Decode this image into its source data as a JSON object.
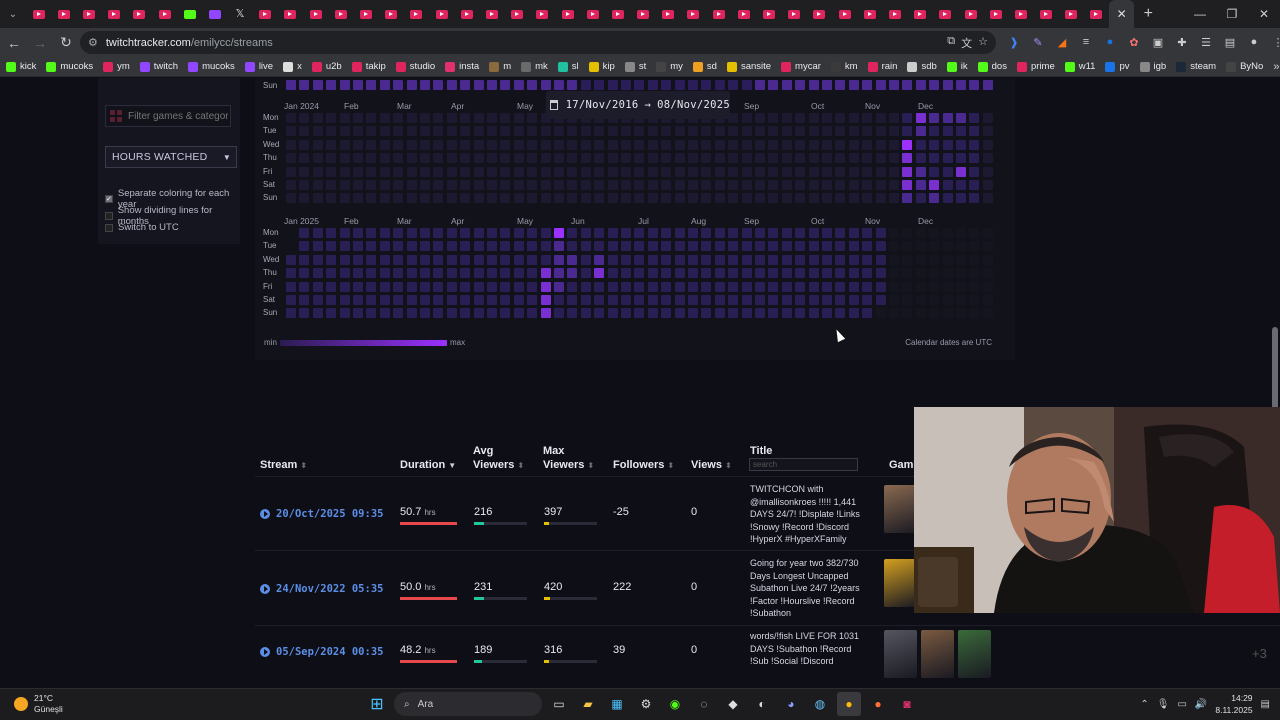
{
  "browser": {
    "tab_count": 44,
    "new_tab": "+",
    "controls": {
      "minimize": "—",
      "maximize": "❐",
      "close": "✕"
    },
    "url_host": "twitchtracker.com",
    "url_path": "/emilycc/streams",
    "bookmarks": [
      {
        "label": "kick",
        "color": "#53fc18"
      },
      {
        "label": "mucoks",
        "color": "#53fc18"
      },
      {
        "label": "ym",
        "color": "#e0245e"
      },
      {
        "label": "twitch",
        "color": "#9146ff"
      },
      {
        "label": "mucoks",
        "color": "#9146ff"
      },
      {
        "label": "live",
        "color": "#9146ff"
      },
      {
        "label": "x",
        "color": "#dddddd"
      },
      {
        "label": "u2b",
        "color": "#e0245e"
      },
      {
        "label": "takip",
        "color": "#e0245e"
      },
      {
        "label": "studio",
        "color": "#e0245e"
      },
      {
        "label": "insta",
        "color": "#e1306c"
      },
      {
        "label": "m",
        "color": "#8a6a3a"
      },
      {
        "label": "mk",
        "color": "#6a6a6a"
      },
      {
        "label": "sl",
        "color": "#20c0a0"
      },
      {
        "label": "kip",
        "color": "#e5c000"
      },
      {
        "label": "st",
        "color": "#888888"
      },
      {
        "label": "my",
        "color": "#444444"
      },
      {
        "label": "sd",
        "color": "#f0a020"
      },
      {
        "label": "sansite",
        "color": "#e5c000"
      },
      {
        "label": "mycar",
        "color": "#e0245e"
      },
      {
        "label": "km",
        "color": "#3a3a3a"
      },
      {
        "label": "rain",
        "color": "#e0245e"
      },
      {
        "label": "sdb",
        "color": "#cccccc"
      },
      {
        "label": "ik",
        "color": "#53fc18"
      },
      {
        "label": "dos",
        "color": "#53fc18"
      },
      {
        "label": "prime",
        "color": "#e0245e"
      },
      {
        "label": "w11",
        "color": "#53fc18"
      },
      {
        "label": "pv",
        "color": "#1a73e8"
      },
      {
        "label": "igb",
        "color": "#888888"
      },
      {
        "label": "steam",
        "color": "#1b2838"
      },
      {
        "label": "ByNo",
        "color": "#444444"
      }
    ],
    "bookmarks_more": "»"
  },
  "sidebar": {
    "filter_placeholder": "Filter games & categories",
    "metric_select": "HOURS WATCHED",
    "options": [
      {
        "label": "Separate coloring for each year",
        "checked": true
      },
      {
        "label": "Show dividing lines for months",
        "checked": false
      },
      {
        "label": "Switch to UTC",
        "checked": false
      }
    ]
  },
  "calendar": {
    "date_range_start": "17/Nov/2016",
    "date_range_arrow": "→",
    "date_range_end": "08/Nov/2025",
    "year_2024_months": [
      "Jan 2024",
      "Feb",
      "Mar",
      "Apr",
      "May",
      "Jun",
      "Jul",
      "Aug",
      "Sep",
      "Oct",
      "Nov",
      "Dec"
    ],
    "year_2025_months": [
      "Jan 2025",
      "Feb",
      "Mar",
      "Apr",
      "May",
      "Jun",
      "Jul",
      "Aug",
      "Sep",
      "Oct",
      "Nov",
      "Dec"
    ],
    "weekdays": [
      "Mon",
      "Tue",
      "Wed",
      "Thu",
      "Fri",
      "Sat",
      "Sun"
    ],
    "prev_row_label": "Sun",
    "legend_min": "min",
    "legend_max": "max",
    "utc_note": "Calendar dates are UTC",
    "colors": {
      "empty": "#1c1930",
      "low": "#2a1f55",
      "mid": "#4a2a90",
      "high": "#7a2fd0",
      "peak": "#9b30ff",
      "future": "#15151f"
    }
  },
  "table": {
    "headers": {
      "stream": "Stream",
      "duration": "Duration",
      "avg_viewers": [
        "Avg",
        "Viewers"
      ],
      "max_viewers": [
        "Max",
        "Viewers"
      ],
      "followers": "Followers",
      "views": "Views",
      "title": "Title",
      "game": "Game"
    },
    "title_search_placeholder": "search",
    "hours_unit": "hrs",
    "rows": [
      {
        "date": "20/Oct/2025 09:35",
        "duration": "50.7",
        "avg": "216",
        "max": "397",
        "followers": "-25",
        "views": "0",
        "title": "TWITCHCON with @imallisonkroes !!!!! 1,441 DAYS 24/7! !Displate !Links !Snowy !Record !Discord !HyperX #HyperXFamily",
        "avg_fill": 0.18,
        "max_fill": 0.1
      },
      {
        "date": "24/Nov/2022 05:35",
        "duration": "50.0",
        "avg": "231",
        "max": "420",
        "followers": "222",
        "views": "0",
        "title": "Going for year two 382/730 Days Longest Uncapped Subathon Live 24/7 !2years !Factor !Hourslive !Record !Subathon",
        "avg_fill": 0.19,
        "max_fill": 0.11
      },
      {
        "date": "05/Sep/2024 00:35",
        "duration": "48.2",
        "avg": "189",
        "max": "316",
        "followers": "39",
        "views": "0",
        "title": "words/!fish LIVE FOR 1031 DAYS !Subathon !Record !Sub !Social !Discord",
        "avg_fill": 0.15,
        "max_fill": 0.09
      }
    ],
    "more_games": "+3"
  },
  "taskbar": {
    "temp": "21°C",
    "weather": "Güneşli",
    "search": "Ara",
    "time": "14:29",
    "date": "8.11.2025"
  }
}
